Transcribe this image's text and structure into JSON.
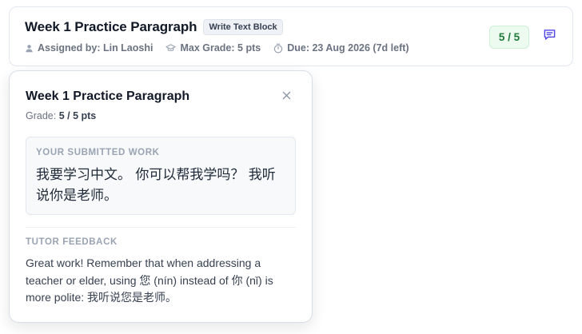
{
  "assignment": {
    "title": "Week 1 Practice Paragraph",
    "type_badge": "Write Text Block",
    "assigned_by": "Assigned by: Lin Laoshi",
    "max_grade": "Max Grade: 5 pts",
    "due": "Due: 23 Aug 2026 (7d left)",
    "score": "5 / 5"
  },
  "popover": {
    "title": "Week 1 Practice Paragraph",
    "grade_label": "Grade:",
    "grade_value": "5 / 5 pts",
    "submitted_label": "YOUR SUBMITTED WORK",
    "submitted_text": "我要学习中文。 你可以帮我学吗？ 我听说你是老师。",
    "feedback_label": "TUTOR FEEDBACK",
    "feedback_text": "Great work! Remember that when addressing a teacher or elder, using 您 (nín) instead of 你 (nǐ) is more polite: 我听说您是老师。"
  },
  "icons": {
    "user": "user-icon",
    "grad_cap": "graduation-cap-icon",
    "timer": "timer-icon",
    "comment": "comment-icon",
    "close": "close-icon"
  },
  "colors": {
    "score_bg": "#ecfaf0",
    "score_text": "#1f7a3a",
    "accent": "#4f46e5"
  }
}
